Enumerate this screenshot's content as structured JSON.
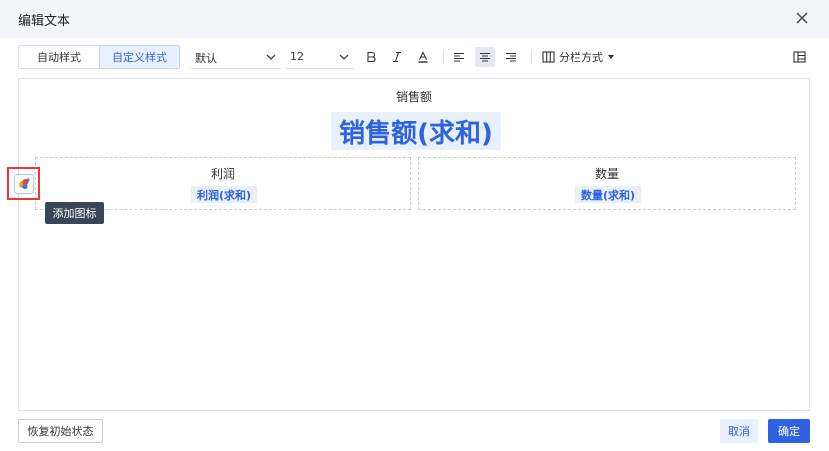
{
  "dialog": {
    "title": "编辑文本"
  },
  "toolbar": {
    "auto_style": "自动样式",
    "custom_style": "自定义样式",
    "font_family": "默认",
    "font_size": "12",
    "column_mode": "分栏方式"
  },
  "canvas": {
    "title_label": "销售额",
    "title_field": "销售额(求和)",
    "columns": [
      {
        "label": "利润",
        "field": "利润(求和)"
      },
      {
        "label": "数量",
        "field": "数量(求和)"
      }
    ]
  },
  "tooltip": {
    "add_icon": "添加图标"
  },
  "footer": {
    "reset": "恢复初始状态",
    "cancel": "取消",
    "ok": "确定"
  },
  "colors": {
    "accent": "#2f62e0",
    "field_bg": "#e8f0fe",
    "highlight": "#e03a3a"
  }
}
